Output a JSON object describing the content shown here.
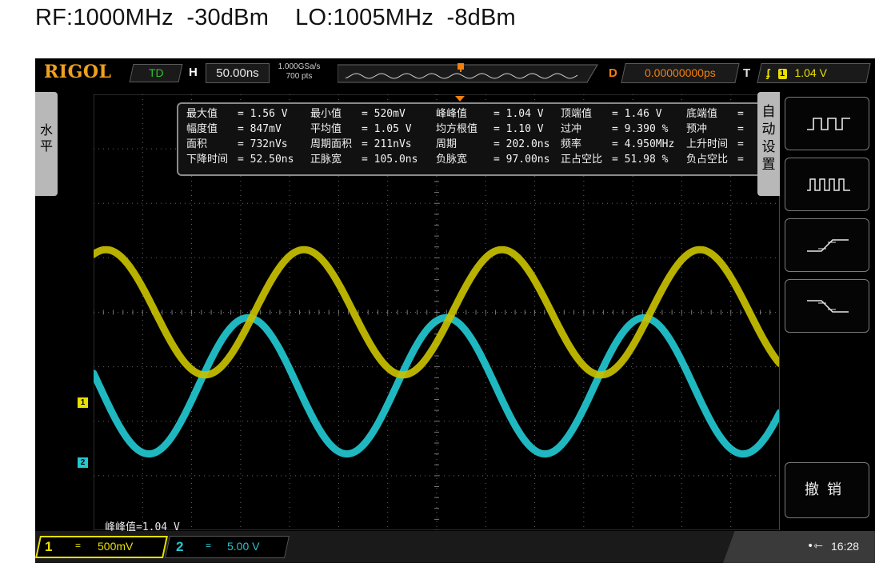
{
  "caption": "RF:1000MHz  -30dBm    LO:1005MHz  -8dBm",
  "topbar": {
    "brand": "RIGOL",
    "run_state": "TD",
    "h_label": "H",
    "timebase": "50.00ns",
    "sample_rate": "1.000GSa/s",
    "memory_depth": "700  pts",
    "delay_label": "D",
    "delay": "0.00000000ps",
    "trigger_label": "T",
    "trigger_source": "1",
    "trigger_level": "1.04 V"
  },
  "left_tab": {
    "label": "水\n平"
  },
  "measurements": [
    {
      "label": "最大值",
      "value": "= 1.56 V"
    },
    {
      "label": "最小值",
      "value": "= 520mV"
    },
    {
      "label": "峰峰值",
      "value": "= 1.04 V"
    },
    {
      "label": "顶端值",
      "value": "= 1.46 V"
    },
    {
      "label": "底端值",
      "value": "="
    },
    {
      "label": "幅度值",
      "value": "= 847mV"
    },
    {
      "label": "平均值",
      "value": "= 1.05 V"
    },
    {
      "label": "均方根值",
      "value": "= 1.10 V"
    },
    {
      "label": "过冲",
      "value": "= 9.390 %"
    },
    {
      "label": "预冲",
      "value": "="
    },
    {
      "label": "面积",
      "value": "= 732nVs"
    },
    {
      "label": "周期面积",
      "value": "= 211nVs"
    },
    {
      "label": "周期",
      "value": "= 202.0ns"
    },
    {
      "label": "频率",
      "value": "= 4.950MHz"
    },
    {
      "label": "上升时间",
      "value": "="
    },
    {
      "label": "下降时间",
      "value": "= 52.50ns"
    },
    {
      "label": "正脉宽",
      "value": "= 105.0ns"
    },
    {
      "label": "负脉宽",
      "value": "= 97.00ns"
    },
    {
      "label": "正占空比",
      "value": "= 51.98 %"
    },
    {
      "label": "负占空比",
      "value": "="
    }
  ],
  "channel_markers": {
    "ch1": "1",
    "ch2": "2"
  },
  "status_text": "峰峰值=1.04 V",
  "right_menu": {
    "auto_tab": "自\n动\n设\n置",
    "buttons": [
      "multi-cycle-icon",
      "single-cycle-icon",
      "rising-edge-icon",
      "falling-edge-icon"
    ],
    "undo": "撤销"
  },
  "bottombar": {
    "ch1_num": "1",
    "ch1_coupling": "=",
    "ch1_scale": "500mV",
    "ch2_num": "2",
    "ch2_coupling": "=",
    "ch2_scale": "5.00 V",
    "usb": "•⇽",
    "clock": "16:28"
  },
  "colors": {
    "ch1": "#c8c000",
    "ch2": "#22c8d0",
    "delay": "#f08010",
    "brand": "#f0a020"
  },
  "waveforms": {
    "ch1": {
      "color": "#c8c000",
      "period_ns": 202.0,
      "vpp_div": 2.3,
      "center_div": 4.0
    },
    "ch2": {
      "color": "#22c8d0",
      "period_ns": 202.0,
      "vpp_div": 2.5,
      "center_div": 5.35
    }
  }
}
